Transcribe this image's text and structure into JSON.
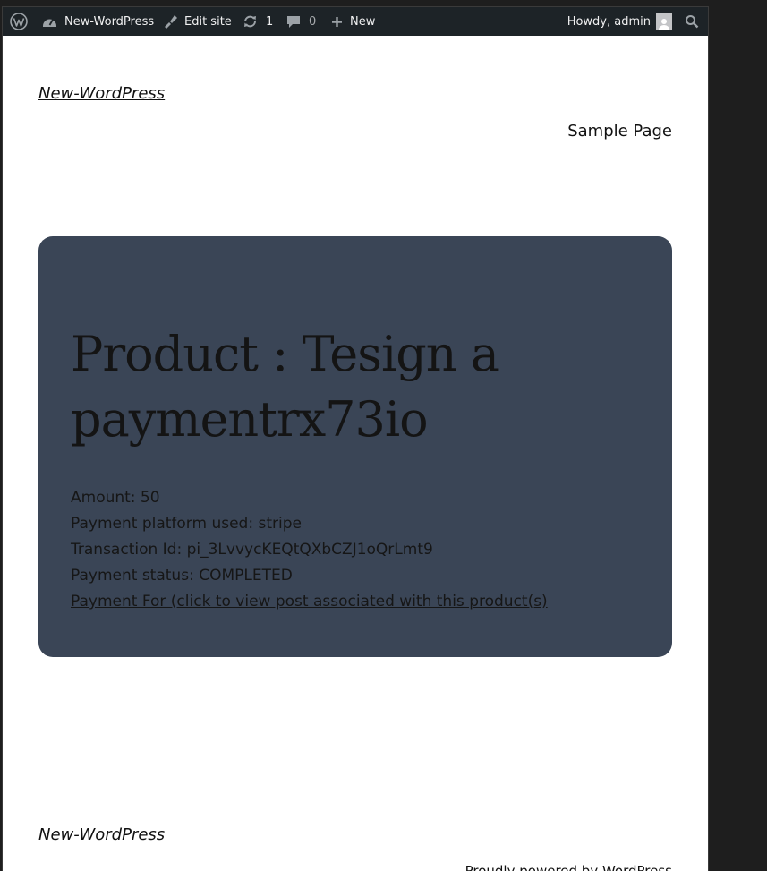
{
  "admin_bar": {
    "wp_logo_icon": "wordpress-icon",
    "site_name": "New-WordPress",
    "edit_site": "Edit site",
    "updates_count": "1",
    "comments_count": "0",
    "new_label": "New",
    "howdy": "Howdy, admin"
  },
  "header": {
    "site_title": "New-WordPress",
    "nav_sample_page": "Sample Page"
  },
  "payment_card": {
    "title": "Product : Tesign a paymentrx73io",
    "amount": "Amount: 50",
    "platform": "Payment platform used: stripe",
    "transaction": "Transaction Id: pi_3LvvycKEQtQXbCZJ1oQrLmt9",
    "status": "Payment status: COMPLETED",
    "link": "Payment For (click to view post associated with this product(s)",
    "background_color": "#3a4556"
  },
  "footer": {
    "site_title": "New-WordPress",
    "credit": "Proudly powered by WordPress"
  }
}
